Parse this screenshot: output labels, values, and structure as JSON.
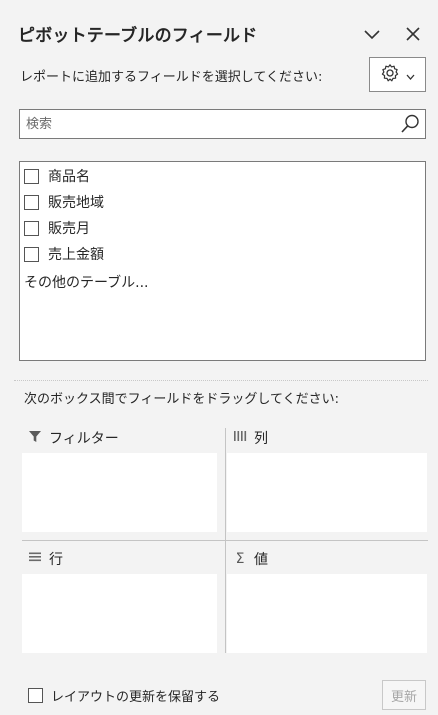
{
  "header": {
    "title": "ピボットテーブルのフィールド",
    "collapse_icon": "chevron-down-icon",
    "close_icon": "close-icon"
  },
  "toolbar": {
    "subtitle": "レポートに追加するフィールドを選択してください:",
    "settings_icon": "gear-icon"
  },
  "search": {
    "placeholder": "検索",
    "value": ""
  },
  "fields": {
    "items": [
      {
        "label": "商品名",
        "checked": false
      },
      {
        "label": "販売地域",
        "checked": false
      },
      {
        "label": "販売月",
        "checked": false
      },
      {
        "label": "売上金額",
        "checked": false
      }
    ],
    "more_tables": "その他のテーブル..."
  },
  "areas": {
    "drag_label": "次のボックス間でフィールドをドラッグしてください:",
    "filter": {
      "label": "フィルター",
      "icon": "filter-icon"
    },
    "columns": {
      "label": "列",
      "icon": "columns-icon"
    },
    "rows": {
      "label": "行",
      "icon": "rows-icon"
    },
    "values": {
      "label": "値",
      "icon": "sigma-icon"
    }
  },
  "footer": {
    "defer_label": "レイアウトの更新を保留する",
    "defer_checked": false,
    "update_label": "更新"
  }
}
